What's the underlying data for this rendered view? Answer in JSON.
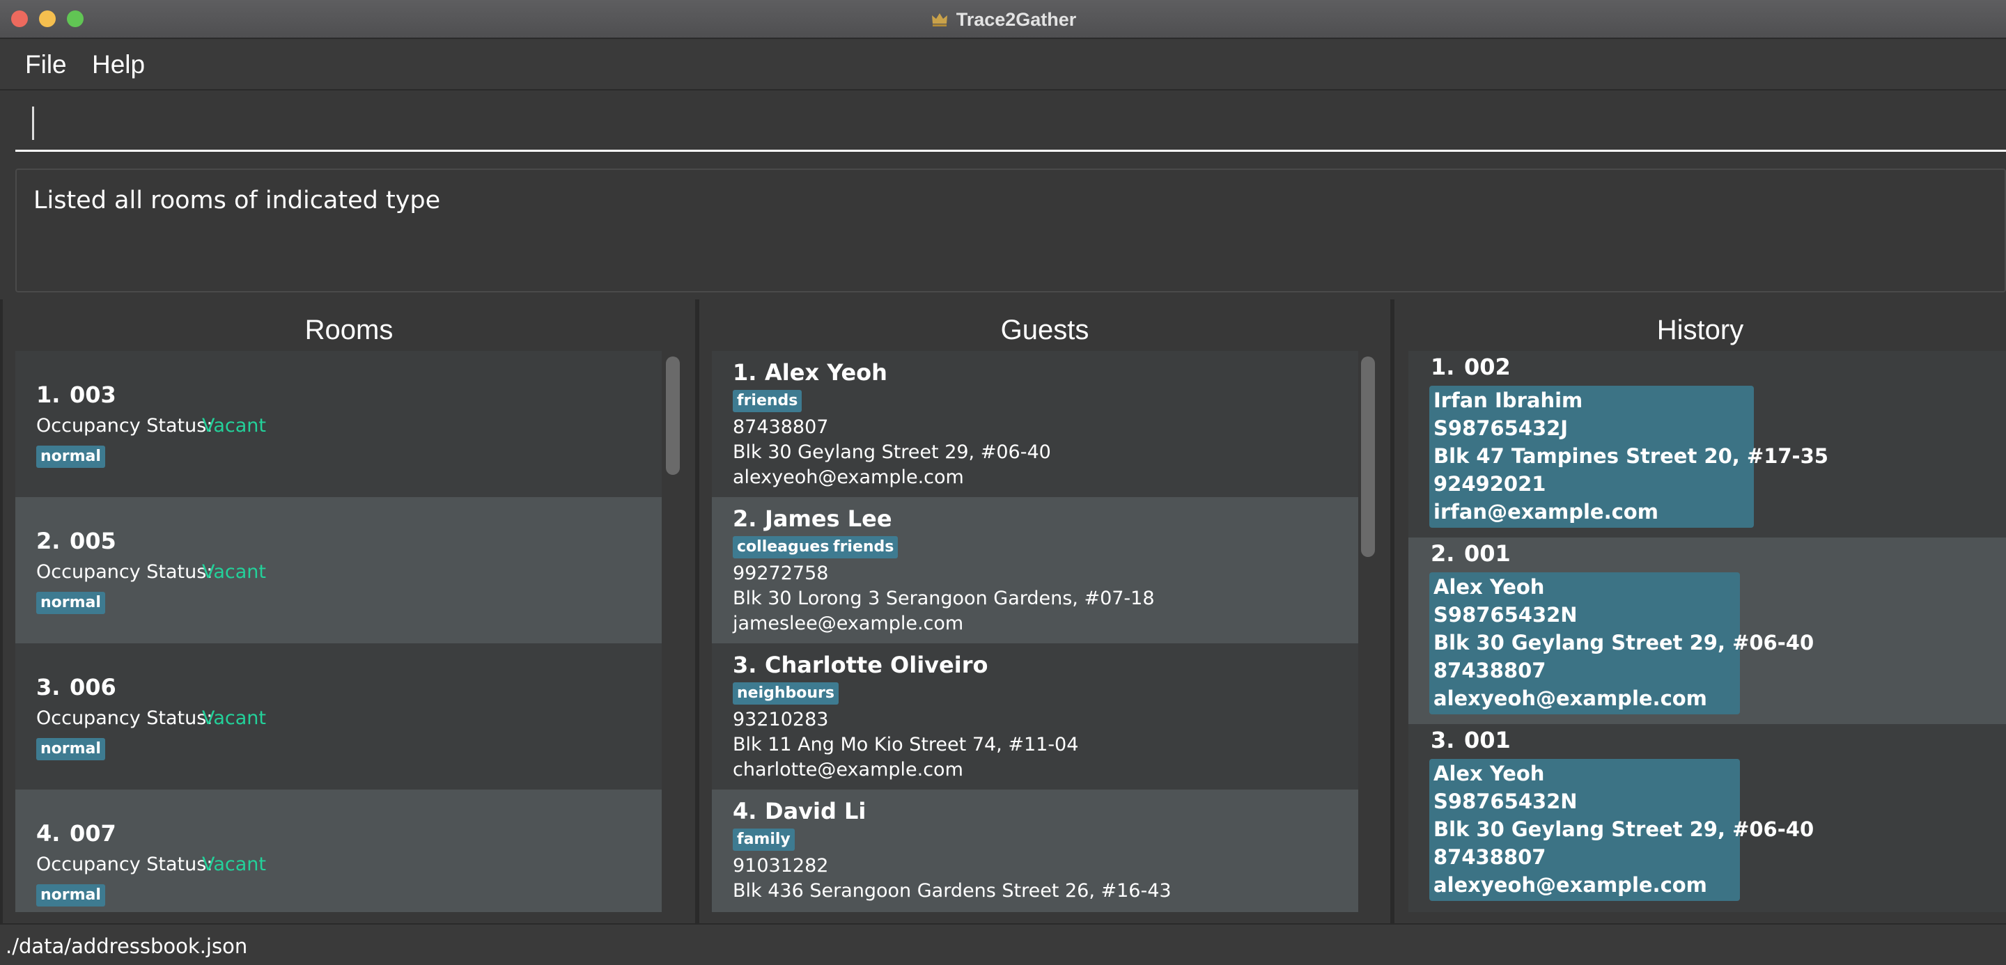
{
  "window": {
    "title": "Trace2Gather",
    "app_icon": "crown-icon"
  },
  "menu": {
    "file": "File",
    "help": "Help"
  },
  "command": {
    "value": "",
    "placeholder": ""
  },
  "result": {
    "text": "Listed all rooms of indicated type"
  },
  "rooms": {
    "heading": "Rooms",
    "status_label": "Occupancy Status:",
    "items": [
      {
        "index": "1.",
        "number": "003",
        "status": "Vacant",
        "tag": "normal"
      },
      {
        "index": "2.",
        "number": "005",
        "status": "Vacant",
        "tag": "normal"
      },
      {
        "index": "3.",
        "number": "006",
        "status": "Vacant",
        "tag": "normal"
      },
      {
        "index": "4.",
        "number": "007",
        "status": "Vacant",
        "tag": "normal"
      }
    ]
  },
  "guests": {
    "heading": "Guests",
    "items": [
      {
        "index": "1.",
        "name": "Alex Yeoh",
        "tags": [
          "friends"
        ],
        "phone": "87438807",
        "address": "Blk 30 Geylang Street 29, #06-40",
        "email": "alexyeoh@example.com"
      },
      {
        "index": "2.",
        "name": "James Lee",
        "tags": [
          "colleagues",
          "friends"
        ],
        "phone": "99272758",
        "address": "Blk 30 Lorong 3 Serangoon Gardens, #07-18",
        "email": "jameslee@example.com"
      },
      {
        "index": "3.",
        "name": "Charlotte Oliveiro",
        "tags": [
          "neighbours"
        ],
        "phone": "93210283",
        "address": "Blk 11 Ang Mo Kio Street 74, #11-04",
        "email": "charlotte@example.com"
      },
      {
        "index": "4.",
        "name": "David Li",
        "tags": [
          "family"
        ],
        "phone": "91031282",
        "address": "Blk 436 Serangoon Gardens Street 26, #16-43",
        "email": ""
      }
    ]
  },
  "history": {
    "heading": "History",
    "items": [
      {
        "index": "1.",
        "room": "002",
        "lines": [
          "Irfan Ibrahim",
          "S98765432J",
          "Blk 47 Tampines Street 20, #17-35",
          "92492021",
          "irfan@example.com"
        ]
      },
      {
        "index": "2.",
        "room": "001",
        "lines": [
          "Alex Yeoh",
          "S98765432N",
          "Blk 30 Geylang Street 29, #06-40",
          "87438807",
          "alexyeoh@example.com"
        ]
      },
      {
        "index": "3.",
        "room": "001",
        "lines": [
          "Alex Yeoh",
          "S98765432N",
          "Blk 30 Geylang Street 29, #06-40",
          "87438807",
          "alexyeoh@example.com"
        ]
      }
    ]
  },
  "status_bar": {
    "path": "./data/addressbook.json"
  },
  "colors": {
    "tag": "#3e7b91",
    "vacant": "#23d19a",
    "history_card": "#3c7385"
  }
}
